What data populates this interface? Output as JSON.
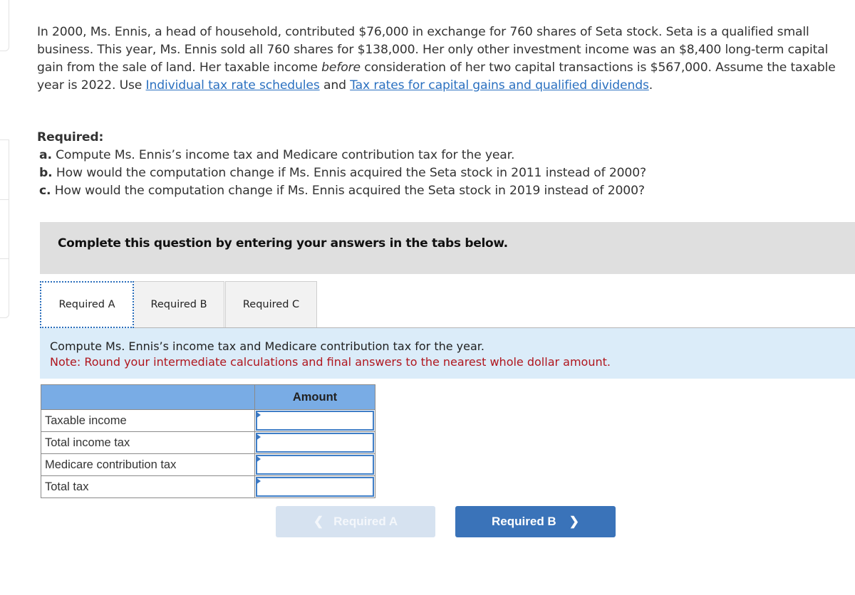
{
  "question": {
    "text_before_links": "In 2000, Ms. Ennis, a head of household, contributed $76,000 in exchange for 760 shares of Seta stock. Seta is a qualified small business. This year, Ms. Ennis sold all 760 shares for $138,000. Her only other investment income was an $8,400 long-term capital gain from the sale of land. Her taxable income ",
    "italic_word": "before",
    "text_after_italic": " consideration of her two capital transactions is $567,000. Assume the taxable year is 2022. Use ",
    "link1": "Individual tax rate schedules",
    "connector": " and ",
    "link2": "Tax rates for capital gains and qualified dividends",
    "end": "."
  },
  "required": {
    "title": "Required:",
    "items": [
      {
        "letter": "a.",
        "text": " Compute Ms. Ennis’s income tax and Medicare contribution tax for the year."
      },
      {
        "letter": "b.",
        "text": " How would the computation change if Ms. Ennis acquired the Seta stock in 2011 instead of 2000?"
      },
      {
        "letter": "c.",
        "text": " How would the computation change if Ms. Ennis acquired the Seta stock in 2019 instead of 2000?"
      }
    ]
  },
  "instruction": "Complete this question by entering your answers in the tabs below.",
  "tabs": [
    {
      "label": "Required A",
      "active": true
    },
    {
      "label": "Required B",
      "active": false
    },
    {
      "label": "Required C",
      "active": false
    }
  ],
  "panel": {
    "prompt": "Compute Ms. Ennis’s income tax and Medicare contribution tax for the year.",
    "note": "Note: Round your intermediate calculations and final answers to the nearest whole dollar amount."
  },
  "table": {
    "header_label": "",
    "header_amount": "Amount",
    "rows": [
      {
        "label": "Taxable income",
        "value": ""
      },
      {
        "label": "Total income tax",
        "value": ""
      },
      {
        "label": "Medicare contribution tax",
        "value": ""
      },
      {
        "label": "Total tax",
        "value": ""
      }
    ]
  },
  "nav": {
    "prev_label": "Required A",
    "prev_icon": "chevron-left-icon",
    "next_label": "Required B",
    "next_icon": "chevron-right-icon"
  },
  "colors": {
    "link": "#2a70c0",
    "note_red": "#b0161e",
    "header_blue": "#79ace5",
    "panel_bg": "#dbecf9",
    "next_button": "#3a73b9",
    "prev_button_disabled": "#d6e2f0"
  }
}
